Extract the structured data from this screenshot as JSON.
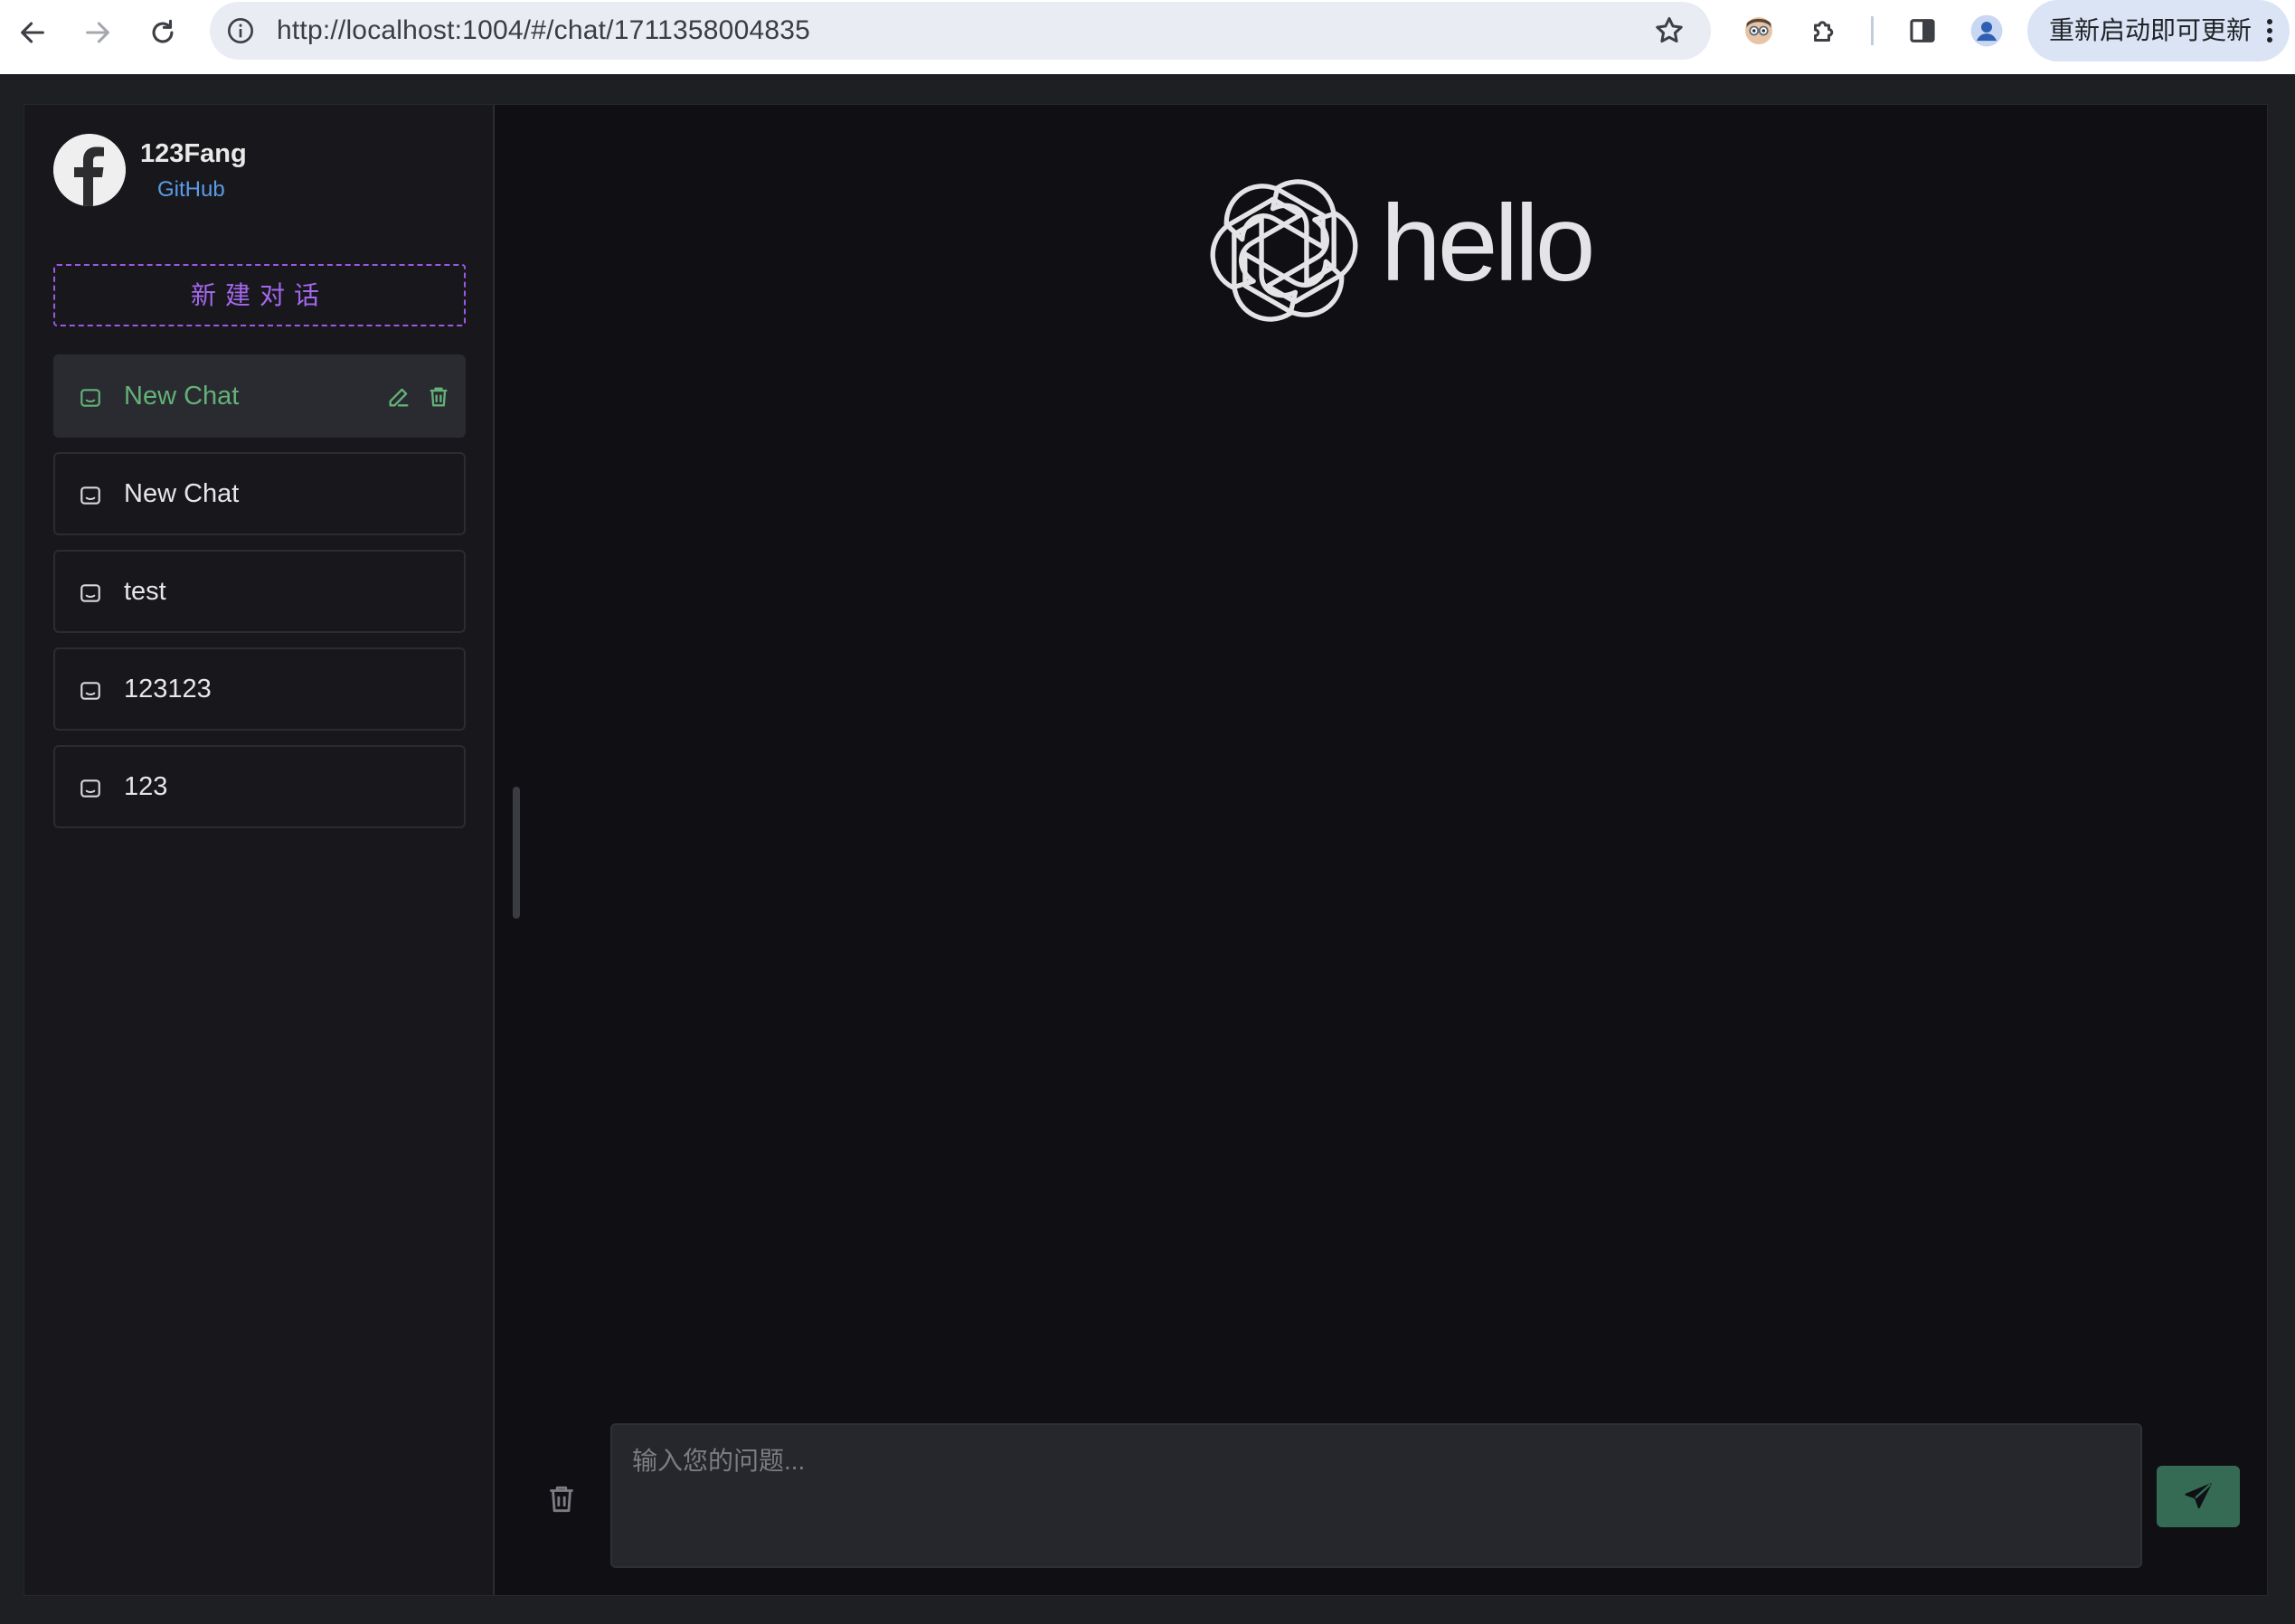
{
  "browser": {
    "url": "http://localhost:1004/#/chat/1711358004835",
    "update_label": "重新启动即可更新"
  },
  "profile": {
    "name": "123Fang",
    "link_label": "GitHub"
  },
  "sidebar": {
    "new_chat_label": "新建对话",
    "chats": [
      {
        "label": "New Chat",
        "active": true
      },
      {
        "label": "New Chat",
        "active": false
      },
      {
        "label": "test",
        "active": false
      },
      {
        "label": "123123",
        "active": false
      },
      {
        "label": "123",
        "active": false
      }
    ]
  },
  "main": {
    "hero_title": "hello"
  },
  "composer": {
    "placeholder": "输入您的问题...",
    "value": ""
  },
  "colors": {
    "accent_purple": "#9b58e8",
    "active_green": "#63b178",
    "send_button": "#356b55",
    "link_blue": "#5a9be6"
  },
  "icons": {
    "back": "arrow-left-icon",
    "forward": "arrow-right-icon",
    "reload": "reload-icon",
    "site_info": "info-icon",
    "bookmark": "star-icon",
    "extension": "puzzle-icon",
    "side_panel": "side-panel-icon",
    "profile": "person-icon",
    "menu": "kebab-icon",
    "chat": "message-icon",
    "edit": "pencil-icon",
    "delete": "trash-icon",
    "send": "send-icon"
  }
}
